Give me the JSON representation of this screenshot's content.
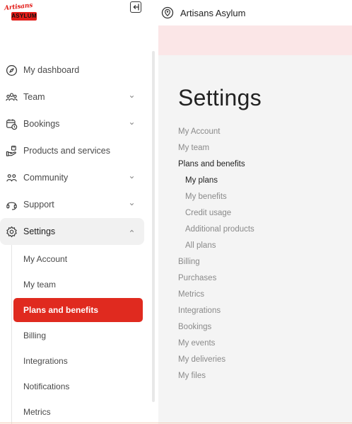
{
  "logo": {
    "script_text": "Artisans",
    "block_text": "ASYLUM",
    "accent": "#e21d19"
  },
  "header": {
    "company_name": "Artisans Asylum",
    "banner_color": "#fbe6e7"
  },
  "sidebar": {
    "items": [
      {
        "label": "My dashboard",
        "icon": "compass-icon",
        "chevron": false
      },
      {
        "label": "Team",
        "icon": "team-icon",
        "chevron": true
      },
      {
        "label": "Bookings",
        "icon": "calendar-clock-icon",
        "chevron": true
      },
      {
        "label": "Products and services",
        "icon": "hand-box-icon",
        "chevron": false
      },
      {
        "label": "Community",
        "icon": "community-icon",
        "chevron": true
      },
      {
        "label": "Support",
        "icon": "headset-icon",
        "chevron": true
      },
      {
        "label": "Settings",
        "icon": "gear-icon",
        "chevron": true,
        "expanded": true
      }
    ],
    "settings_sub": [
      {
        "label": "My Account"
      },
      {
        "label": "My team"
      },
      {
        "label": "Plans and benefits",
        "selected": true
      },
      {
        "label": "Billing"
      },
      {
        "label": "Integrations"
      },
      {
        "label": "Notifications"
      },
      {
        "label": "Metrics"
      }
    ],
    "selected_color": "#e02a1f"
  },
  "main": {
    "title": "Settings",
    "menu": [
      {
        "label": "My Account"
      },
      {
        "label": "My team"
      },
      {
        "label": "Plans and benefits",
        "current": true
      },
      {
        "label": "My plans",
        "indent": true,
        "current": true
      },
      {
        "label": "My benefits",
        "indent": true
      },
      {
        "label": "Credit usage",
        "indent": true
      },
      {
        "label": "Additional products",
        "indent": true
      },
      {
        "label": "All plans",
        "indent": true
      },
      {
        "label": "Billing"
      },
      {
        "label": "Purchases"
      },
      {
        "label": "Metrics"
      },
      {
        "label": "Integrations"
      },
      {
        "label": "Bookings"
      },
      {
        "label": "My events"
      },
      {
        "label": "My deliveries"
      },
      {
        "label": "My files"
      }
    ]
  }
}
